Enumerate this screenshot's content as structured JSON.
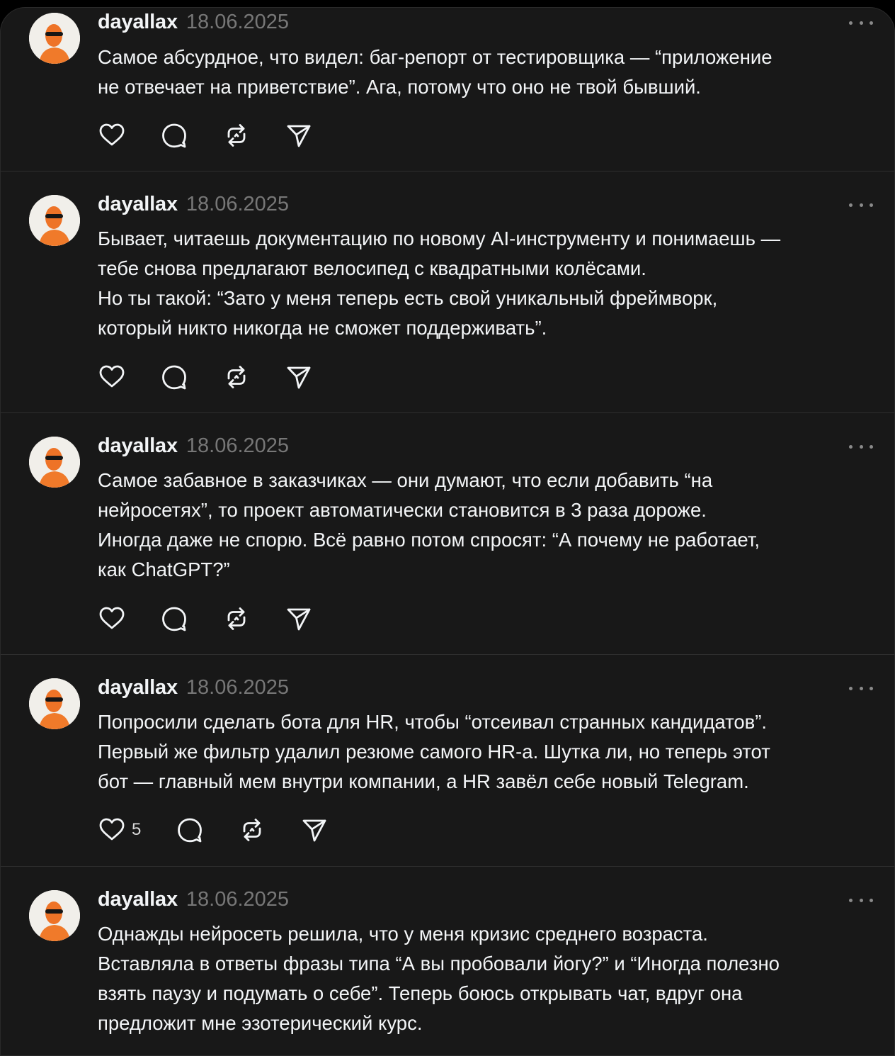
{
  "posts": [
    {
      "username": "dayallax",
      "date": "18.06.2025",
      "lines": [
        "Самое абсурдное, что видел: баг-репорт от тестировщика — “приложение",
        "не отвечает на приветствие”. Ага, потому что оно не твой бывший."
      ],
      "likes": ""
    },
    {
      "username": "dayallax",
      "date": "18.06.2025",
      "lines": [
        "Бывает, читаешь документацию по новому AI-инструменту и понимаешь —",
        "тебе снова предлагают велосипед с квадратными колёсами.",
        "Но ты такой: “Зато у меня теперь есть свой уникальный фреймворк,",
        "который никто никогда не сможет поддерживать”."
      ],
      "likes": ""
    },
    {
      "username": "dayallax",
      "date": "18.06.2025",
      "lines": [
        "Самое забавное в заказчиках — они думают, что если добавить “на",
        "нейросетях”, то проект автоматически становится в 3 раза дороже.",
        "Иногда даже не спорю. Всё равно потом спросят: “А почему не работает,",
        "как ChatGPT?”"
      ],
      "likes": ""
    },
    {
      "username": "dayallax",
      "date": "18.06.2025",
      "lines": [
        "Попросили сделать бота для HR, чтобы “отсеивал странных кандидатов”.",
        "Первый же фильтр удалил резюме самого HR-а. Шутка ли, но теперь этот",
        "бот — главный мем внутри компании, а HR завёл себе новый Telegram."
      ],
      "likes": "5"
    },
    {
      "username": "dayallax",
      "date": "18.06.2025",
      "lines": [
        "Однажды нейросеть решила, что у меня кризис среднего возраста.",
        "Вставляла в ответы фразы типа “А вы пробовали йогу?” и “Иногда полезно",
        "взять паузу и подумать о себе”. Теперь боюсь открывать чат, вдруг она",
        "предложит мне эзотерический курс."
      ],
      "likes": ""
    }
  ],
  "icons": {
    "like": "heart-icon",
    "reply": "comment-bubble-icon",
    "repost": "repost-icon",
    "share": "send-icon",
    "more": "more-dots-icon"
  },
  "colors": {
    "background": "#000000",
    "card": "#181818",
    "text": "#f3f5f7",
    "muted": "#777777",
    "divider": "#2e2e2e",
    "avatar_accent": "#f07a2a"
  }
}
